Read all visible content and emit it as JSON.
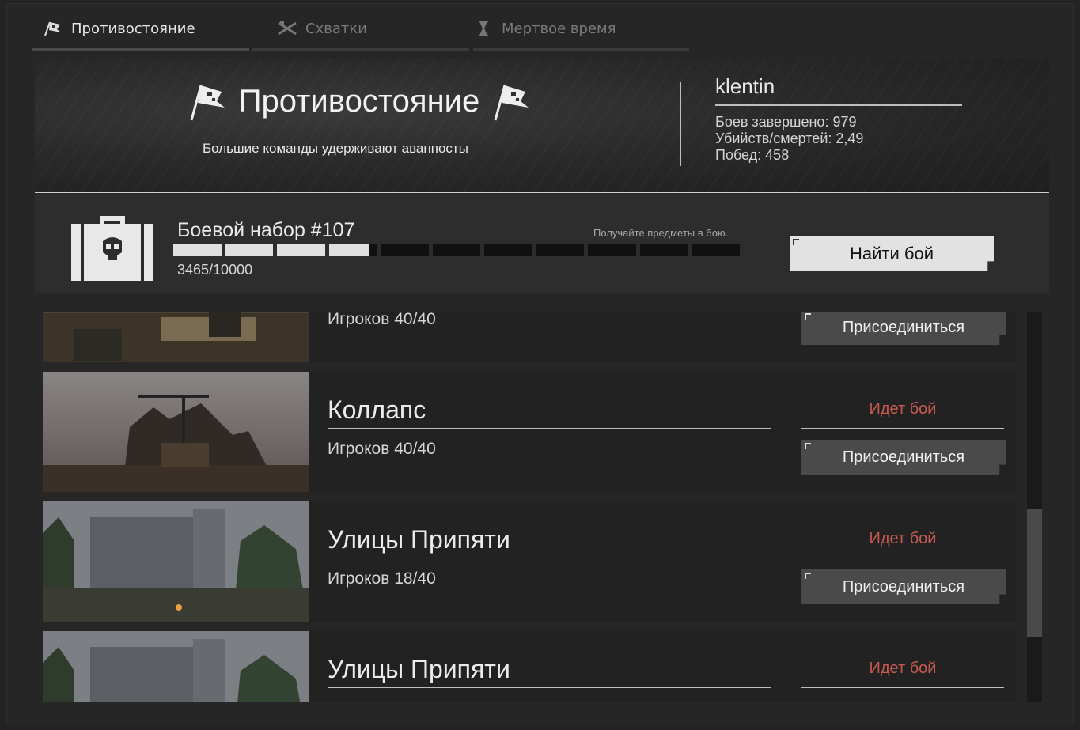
{
  "tabs": [
    {
      "label": "Противостояние",
      "icon": "flag-icon",
      "active": true
    },
    {
      "label": "Схватки",
      "icon": "crossed-guns-icon",
      "active": false
    },
    {
      "label": "Мертвое время",
      "icon": "hourglass-icon",
      "active": false
    }
  ],
  "banner": {
    "title": "Противостояние",
    "subtitle": "Большие команды удерживают аванпосты",
    "player": "klentin",
    "stats": {
      "battles": "Боев завершено: 979",
      "kd": "Убийств/смертей: 2,49",
      "wins": "Побед: 458"
    }
  },
  "kit": {
    "title": "Боевой набор #107",
    "hint": "Получайте предметы в бою.",
    "progress_text": "3465/10000",
    "progress_value": 0.3465,
    "segments": 11,
    "find_button": "Найти бой"
  },
  "matches": [
    {
      "name": "",
      "players": "Игроков 40/40",
      "status": "",
      "join": "Присоединиться"
    },
    {
      "name": "Коллапс",
      "players": "Игроков 40/40",
      "status": "Идет бой",
      "join": "Присоединиться"
    },
    {
      "name": "Улицы Припяти",
      "players": "Игроков 18/40",
      "status": "Идет бой",
      "join": "Присоединиться"
    },
    {
      "name": "Улицы Припяти",
      "players": "",
      "status": "Идет бой",
      "join": ""
    }
  ],
  "colors": {
    "status_red": "#c65a50",
    "button_light": "#e2e2e2",
    "button_dark": "#4a4a4a"
  }
}
